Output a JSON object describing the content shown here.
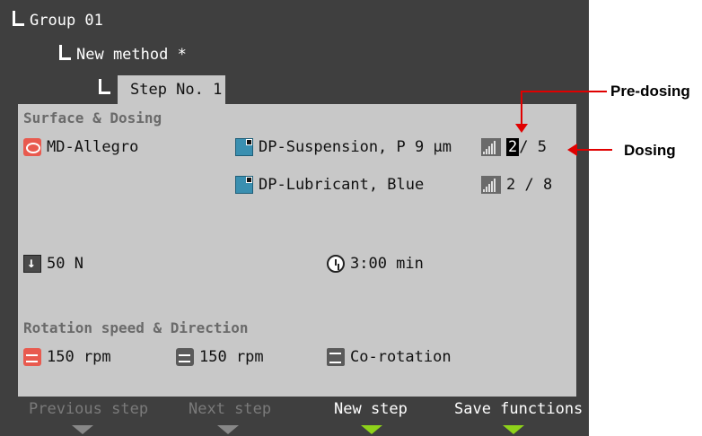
{
  "tree": {
    "group": "Group 01",
    "method": "New method *",
    "step_tab": "Step No. 1"
  },
  "surface_dosing": {
    "title": "Surface & Dosing",
    "surface": "MD-Allegro",
    "suspension": "DP-Suspension, P 9 µm",
    "lubricant": "DP-Lubricant, Blue",
    "dosing1_pre": "2",
    "dosing1_rest": " / 5",
    "dosing2": "2 / 8",
    "force": "50 N",
    "time": "3:00 min"
  },
  "rotation": {
    "title": "Rotation speed & Direction",
    "disc_speed": "150 rpm",
    "holder_speed": "150 rpm",
    "direction": "Co-rotation"
  },
  "softkeys": {
    "previous": "Previous step",
    "next": "Next step",
    "new_step": "New step",
    "save": "Save functions"
  },
  "annotations": {
    "pre_dosing": "Pre-dosing",
    "dosing": "Dosing"
  },
  "colors": {
    "screen_bg": "#3f3f3f",
    "panel_bg": "#c8c8c8",
    "accent_green": "#8ed21a",
    "annotation_red": "#e00000"
  }
}
